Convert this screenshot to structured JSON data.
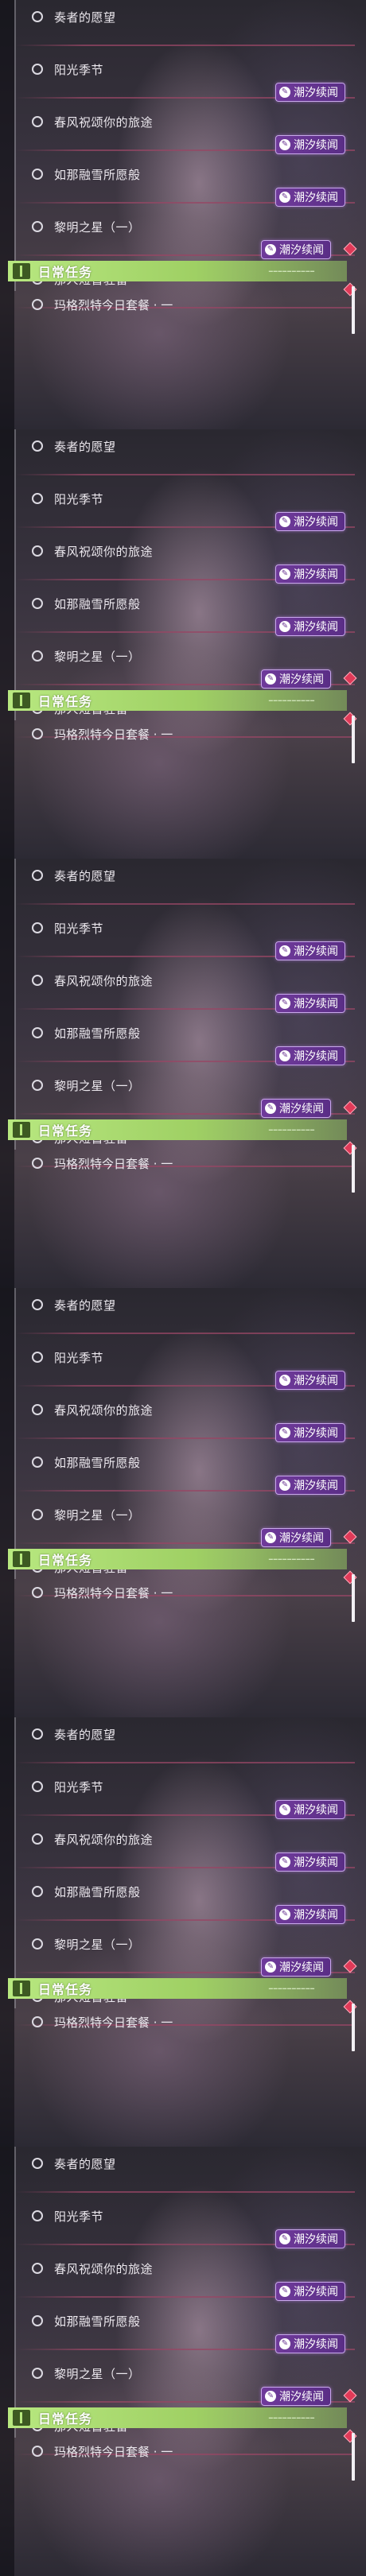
{
  "panels": [
    {
      "quests": [
        {
          "label": "奏者的愿望",
          "badge": ""
        },
        {
          "label": "阳光季节",
          "badge": "潮汐续闻"
        },
        {
          "label": "春风祝颂你的旅途",
          "badge": "潮汐续闻"
        },
        {
          "label": "如那融雪所愿般",
          "badge": "潮汐续闻"
        },
        {
          "label": "黎明之星（一）",
          "badge": "潮汐续闻"
        },
        {
          "label": "那人短暂驻留",
          "badge": ""
        }
      ],
      "section_title": "日常任务",
      "daily_label": "玛格烈特今日套餐 · 一"
    },
    {
      "quests": [
        {
          "label": "奏者的愿望",
          "badge": ""
        },
        {
          "label": "阳光季节",
          "badge": "潮汐续闻"
        },
        {
          "label": "春风祝颂你的旅途",
          "badge": "潮汐续闻"
        },
        {
          "label": "如那融雪所愿般",
          "badge": "潮汐续闻"
        },
        {
          "label": "黎明之星（一）",
          "badge": "潮汐续闻"
        },
        {
          "label": "那人短暂驻留",
          "badge": ""
        }
      ],
      "section_title": "日常任务",
      "daily_label": "玛格烈特今日套餐 · 一"
    },
    {
      "quests": [
        {
          "label": "奏者的愿望",
          "badge": ""
        },
        {
          "label": "阳光季节",
          "badge": "潮汐续闻"
        },
        {
          "label": "春风祝颂你的旅途",
          "badge": "潮汐续闻"
        },
        {
          "label": "如那融雪所愿般",
          "badge": "潮汐续闻"
        },
        {
          "label": "黎明之星（一）",
          "badge": "潮汐续闻"
        },
        {
          "label": "那人短暂驻留",
          "badge": ""
        }
      ],
      "section_title": "日常任务",
      "daily_label": "玛格烈特今日套餐 · 一"
    },
    {
      "quests": [
        {
          "label": "奏者的愿望",
          "badge": ""
        },
        {
          "label": "阳光季节",
          "badge": "潮汐续闻"
        },
        {
          "label": "春风祝颂你的旅途",
          "badge": "潮汐续闻"
        },
        {
          "label": "如那融雪所愿般",
          "badge": "潮汐续闻"
        },
        {
          "label": "黎明之星（一）",
          "badge": "潮汐续闻"
        },
        {
          "label": "那人短暂驻留",
          "badge": ""
        }
      ],
      "section_title": "日常任务",
      "daily_label": "玛格烈特今日套餐 · 一"
    },
    {
      "quests": [
        {
          "label": "奏者的愿望",
          "badge": ""
        },
        {
          "label": "阳光季节",
          "badge": "潮汐续闻"
        },
        {
          "label": "春风祝颂你的旅途",
          "badge": "潮汐续闻"
        },
        {
          "label": "如那融雪所愿般",
          "badge": "潮汐续闻"
        },
        {
          "label": "黎明之星（一）",
          "badge": "潮汐续闻"
        },
        {
          "label": "那人短暂驻留",
          "badge": ""
        }
      ],
      "section_title": "日常任务",
      "daily_label": "玛格烈特今日套餐 · 一"
    },
    {
      "quests": [
        {
          "label": "奏者的愿望",
          "badge": ""
        },
        {
          "label": "阳光季节",
          "badge": "潮汐续闻"
        },
        {
          "label": "春风祝颂你的旅途",
          "badge": "潮汐续闻"
        },
        {
          "label": "如那融雪所愿般",
          "badge": "潮汐续闻"
        },
        {
          "label": "黎明之星（一）",
          "badge": "潮汐续闻"
        },
        {
          "label": "那人短暂驻留",
          "badge": ""
        }
      ],
      "section_title": "日常任务",
      "daily_label": "玛格烈特今日套餐 · 一"
    }
  ],
  "colors": {
    "header_green": "#b8e880",
    "badge_purple": "#6f3a9a",
    "alert_red": "#e03a58",
    "separator": "#964664"
  },
  "icons": {
    "quest_bubble": "circle-outline-icon",
    "badge": "story-badge-icon",
    "alert": "red-diamond-icon",
    "section": "book-icon"
  }
}
